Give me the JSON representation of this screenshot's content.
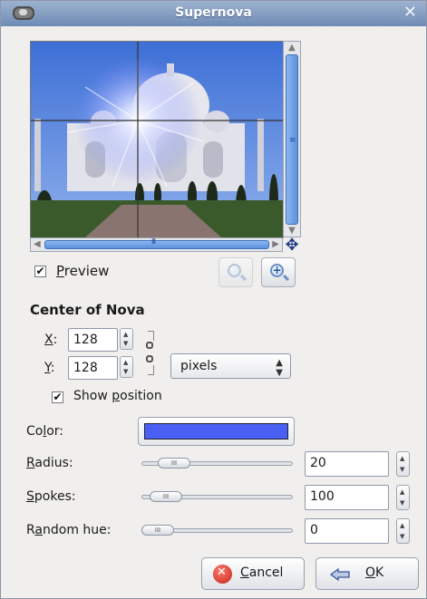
{
  "window": {
    "title": "Supernova",
    "close_icon": "close-icon"
  },
  "preview": {
    "checkbox_checked": true,
    "label_pre": "",
    "label_underlined": "P",
    "label_post": "review"
  },
  "center": {
    "section_title": "Center of Nova",
    "x_label_u": "X",
    "x_label_rest": ":",
    "x_value": "128",
    "y_label_u": "Y",
    "y_label_rest": ":",
    "y_value": "128",
    "unit": "pixels",
    "show_position_checked": true,
    "show_position_pre": "Show ",
    "show_position_u": "p",
    "show_position_post": "osition"
  },
  "params": {
    "color_label_pre": "Co",
    "color_label_u": "l",
    "color_label_post": "or:",
    "color_value": "#4a5ff4",
    "radius_label_u": "R",
    "radius_label_rest": "adius:",
    "radius_value": "20",
    "radius_fraction": 0.14,
    "spokes_label_u": "S",
    "spokes_label_rest": "pokes:",
    "spokes_value": "100",
    "spokes_fraction": 0.07,
    "hue_label_pre": "R",
    "hue_label_u": "a",
    "hue_label_post": "ndom hue:",
    "hue_value": "0",
    "hue_fraction": 0.0
  },
  "buttons": {
    "cancel_u": "C",
    "cancel_rest": "ancel",
    "ok_u": "O",
    "ok_rest": "K"
  }
}
